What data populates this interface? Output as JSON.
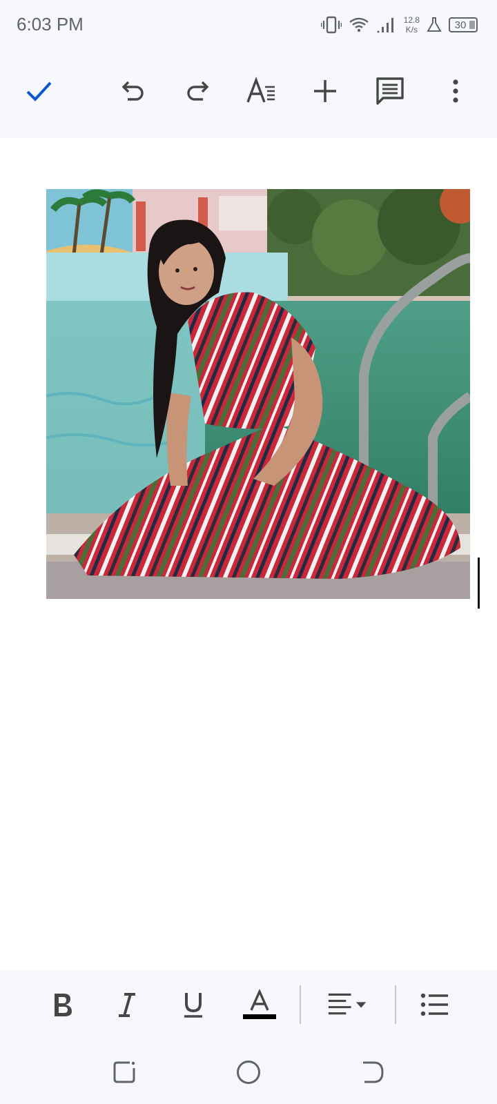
{
  "status_bar": {
    "time": "6:03 PM",
    "net_speed_value": "12.8",
    "net_speed_unit": "K/s",
    "battery": "30",
    "icons": [
      "vibrate-icon",
      "wifi-icon",
      "signal-icon",
      "lab-flask-icon",
      "battery-icon"
    ]
  },
  "toolbar": {
    "icons": [
      "check-icon",
      "undo-icon",
      "redo-icon",
      "text-format-icon",
      "add-icon",
      "comment-icon",
      "more-vert-icon"
    ],
    "accent_color": "#0b57d0"
  },
  "document": {
    "image": "photo of woman in striped dress sitting by a swimming pool"
  },
  "format_bar": {
    "icons": [
      "bold-icon",
      "italic-icon",
      "underline-icon",
      "text-color-icon",
      "align-left-icon",
      "bullet-list-icon"
    ],
    "text_color_swatch": "#000000"
  },
  "nav_bar": {
    "icons": [
      "recents-icon",
      "home-icon",
      "back-icon"
    ]
  }
}
